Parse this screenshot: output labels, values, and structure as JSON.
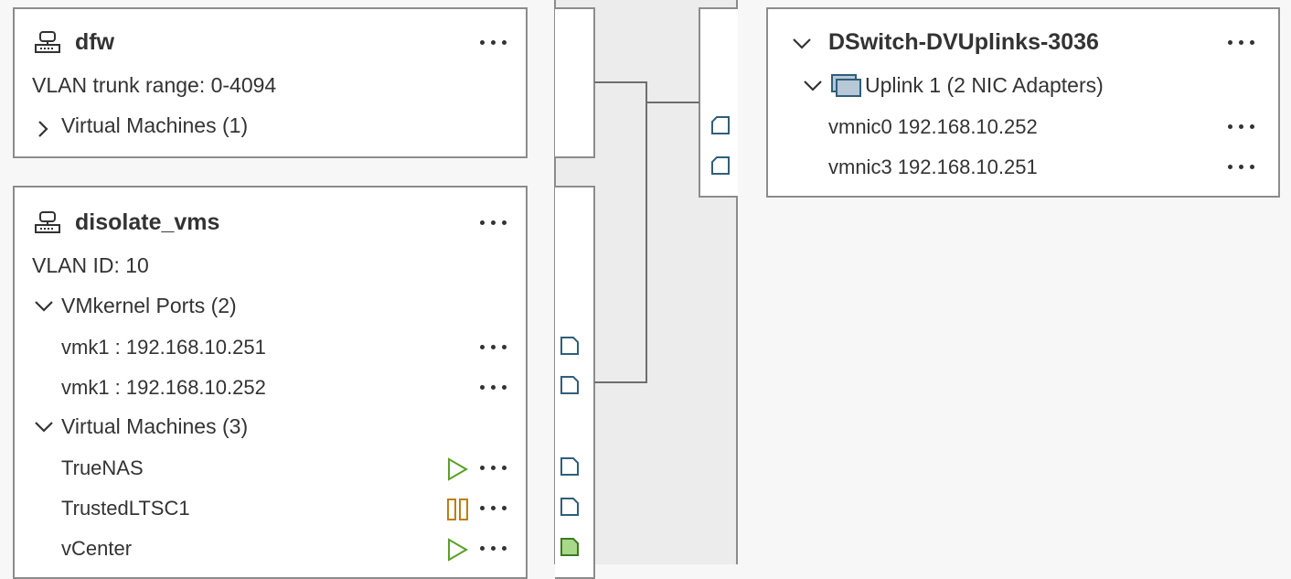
{
  "portgroups": [
    {
      "name": "dfw",
      "detail": "VLAN trunk range: 0-4094",
      "vm_section": "Virtual Machines (1)"
    },
    {
      "name": "disolate_vms",
      "detail": "VLAN ID: 10",
      "vmkernel_section": "VMkernel Ports (2)",
      "vmkernel_ports": [
        "vmk1 : 192.168.10.251",
        "vmk1 : 192.168.10.252"
      ],
      "vm_section": "Virtual Machines (3)",
      "vms": [
        {
          "name": "TrueNAS",
          "state": "powered-on"
        },
        {
          "name": "TrustedLTSC1",
          "state": "suspended"
        },
        {
          "name": "vCenter",
          "state": "powered-on"
        }
      ]
    }
  ],
  "uplinks": {
    "name": "DSwitch-DVUplinks-3036",
    "uplink_label": "Uplink 1 (2 NIC Adapters)",
    "nics": [
      "vmnic0 192.168.10.252",
      "vmnic3 192.168.10.251"
    ]
  },
  "colors": {
    "border": "#8c8c8c",
    "port_blue": "#2f5f7a",
    "play_green": "#5aa227",
    "pause_orange": "#c27c0e",
    "port_active_fill": "#a8d98a"
  }
}
